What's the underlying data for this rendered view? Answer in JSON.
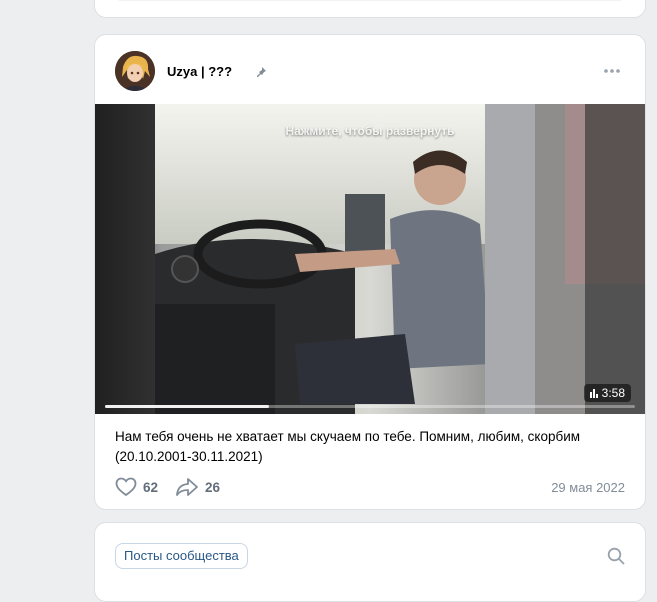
{
  "post": {
    "author": "Uzya | ???",
    "video": {
      "expand_hint": "Нажмите, чтобы развернуть",
      "duration": "3:58",
      "progress_fraction": 0.31
    },
    "text_line1": "Нам тебя очень не хватает мы скучаем по тебе. Помним, любим, скорбим",
    "text_line2": "(20.10.2001-30.11.2021)",
    "likes": "62",
    "shares": "26",
    "date": "29 мая 2022"
  },
  "community": {
    "posts_tab_label": "Посты сообщества"
  },
  "colors": {
    "page_bg": "#edeef0",
    "card_bg": "#ffffff",
    "link": "#2a5885",
    "muted": "#818c99"
  },
  "icons": [
    "pin-icon",
    "more-icon",
    "heart-icon",
    "share-icon",
    "search-icon",
    "video-bars-icon"
  ]
}
